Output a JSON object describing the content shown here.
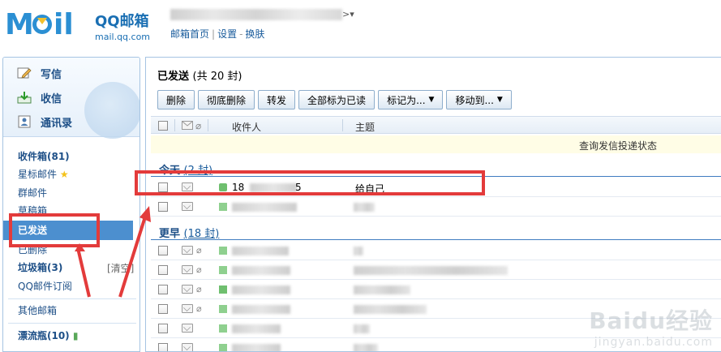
{
  "header": {
    "logo_text": "MOil",
    "brand_title": "QQ邮箱",
    "brand_domain": "mail.qq.com",
    "account_caret": "▾",
    "links": [
      "邮箱首页",
      "设置",
      "换肤"
    ]
  },
  "sidebar": {
    "compose": "写信",
    "inbox_action": "收信",
    "contacts": "通讯录",
    "folders": {
      "inbox": "收件箱(81)",
      "starred": "星标邮件",
      "group": "群邮件",
      "drafts": "草稿箱",
      "sent": "已发送",
      "deleted": "已删除",
      "junk": "垃圾箱(3)",
      "junk_clear": "[清空]",
      "subscription": "QQ邮件订阅",
      "other": "其他邮箱",
      "bottle": "漂流瓶(10)"
    }
  },
  "main": {
    "title": "已发送",
    "title_count": "(共 20 封)",
    "toolbar": {
      "delete": "删除",
      "delete_permanently": "彻底删除",
      "forward": "转发",
      "mark_all_read": "全部标为已读",
      "mark_as": "标记为...",
      "move_to": "移动到..."
    },
    "columns": {
      "recipient": "收件人",
      "subject": "主题"
    },
    "tracking_link": "查询发信投递状态",
    "groups": {
      "today_label": "今天",
      "today_count": "(2 封)",
      "earlier_label": "更早",
      "earlier_count": "(18 封)"
    },
    "rows": {
      "today_1_recipient": "18",
      "today_1_suffix": "5",
      "today_1_subject": "给自己"
    }
  },
  "watermark": {
    "brand": "Baidu经验",
    "url": "jingyan.baidu.com"
  },
  "colors": {
    "accent": "#2b8fd3",
    "sidebar_active": "#4c8fcf",
    "annotation": "#e33b3b"
  }
}
